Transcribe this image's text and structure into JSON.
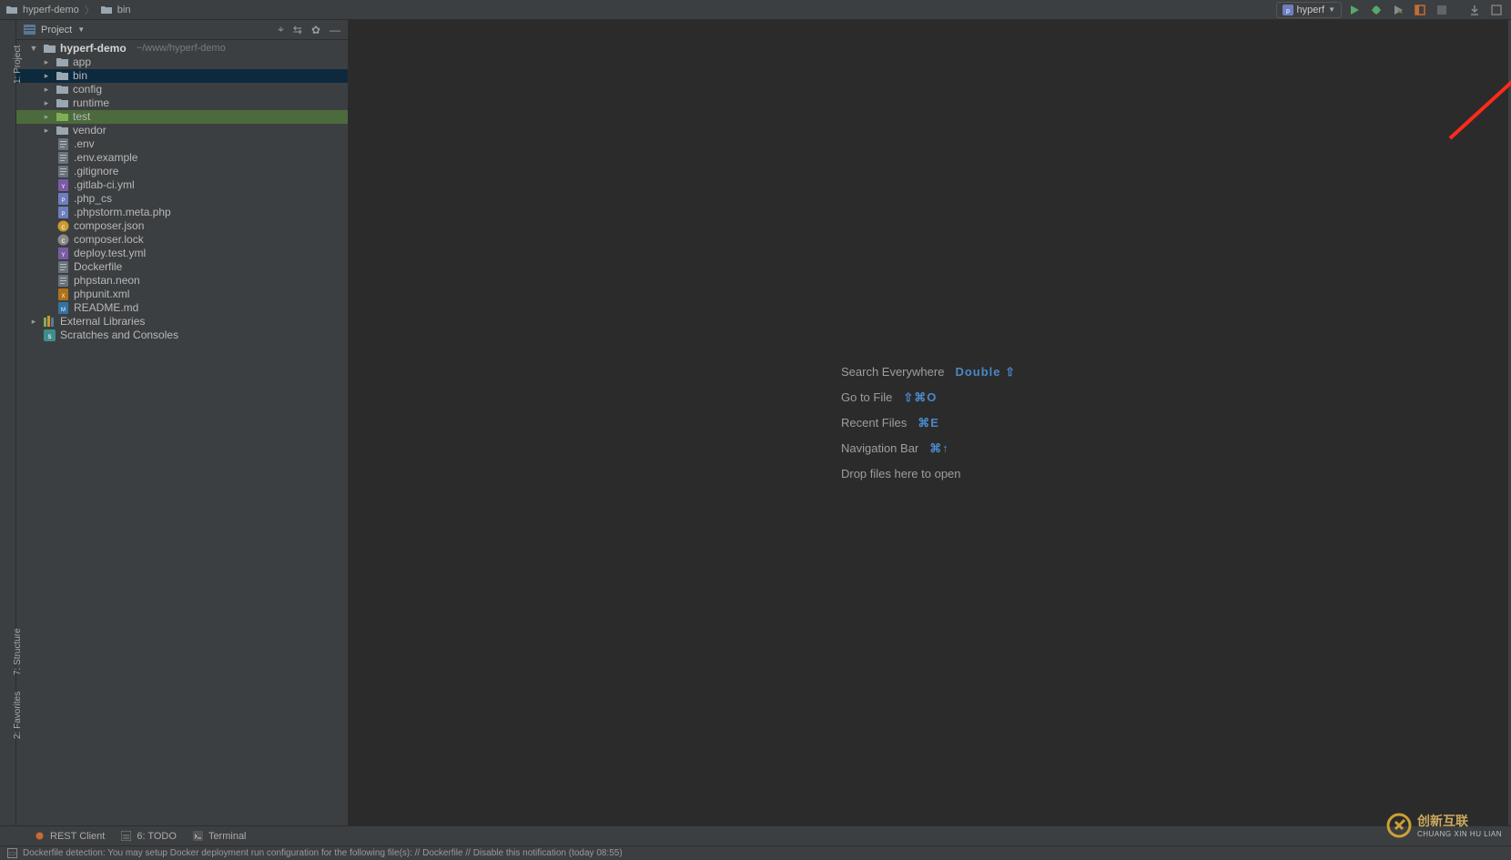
{
  "breadcrumb": {
    "root": "hyperf-demo",
    "segments": [
      "bin"
    ]
  },
  "run_config": {
    "label": "hyperf"
  },
  "panel": {
    "title": "Project"
  },
  "tree": {
    "root": {
      "name": "hyperf-demo",
      "path": "~/www/hyperf-demo"
    },
    "folders": [
      {
        "name": "app",
        "state": "collapsed",
        "kind": "folder"
      },
      {
        "name": "bin",
        "state": "collapsed",
        "kind": "folder",
        "selected": true
      },
      {
        "name": "config",
        "state": "collapsed",
        "kind": "folder"
      },
      {
        "name": "runtime",
        "state": "collapsed",
        "kind": "folder"
      },
      {
        "name": "test",
        "state": "collapsed",
        "kind": "folder-test",
        "highlight": true
      },
      {
        "name": "vendor",
        "state": "collapsed",
        "kind": "folder"
      }
    ],
    "files": [
      ".env",
      ".env.example",
      ".gitignore",
      ".gitlab-ci.yml",
      ".php_cs",
      ".phpstorm.meta.php",
      "composer.json",
      "composer.lock",
      "deploy.test.yml",
      "Dockerfile",
      "phpstan.neon",
      "phpunit.xml",
      "README.md"
    ],
    "extra": [
      {
        "name": "External Libraries",
        "kind": "lib"
      },
      {
        "name": "Scratches and Consoles",
        "kind": "scratch"
      }
    ]
  },
  "shortcuts": [
    {
      "label": "Search Everywhere",
      "keys": "Double ⇧"
    },
    {
      "label": "Go to File",
      "keys": "⇧⌘O"
    },
    {
      "label": "Recent Files",
      "keys": "⌘E"
    },
    {
      "label": "Navigation Bar",
      "keys": "⌘↑"
    },
    {
      "label": "Drop files here to open",
      "keys": ""
    }
  ],
  "left_gutter_tabs": [
    "1: Project",
    "7: Structure",
    "2: Favorites"
  ],
  "bottom_tabs": [
    "REST Client",
    "6: TODO",
    "Terminal"
  ],
  "status": {
    "text": "Dockerfile detection: You may setup Docker deployment run configuration for the following file(s): // Dockerfile // Disable this notification (today 08:55)"
  },
  "watermark": {
    "zh": "创新互联",
    "en": "CHUANG XIN HU LIAN"
  }
}
